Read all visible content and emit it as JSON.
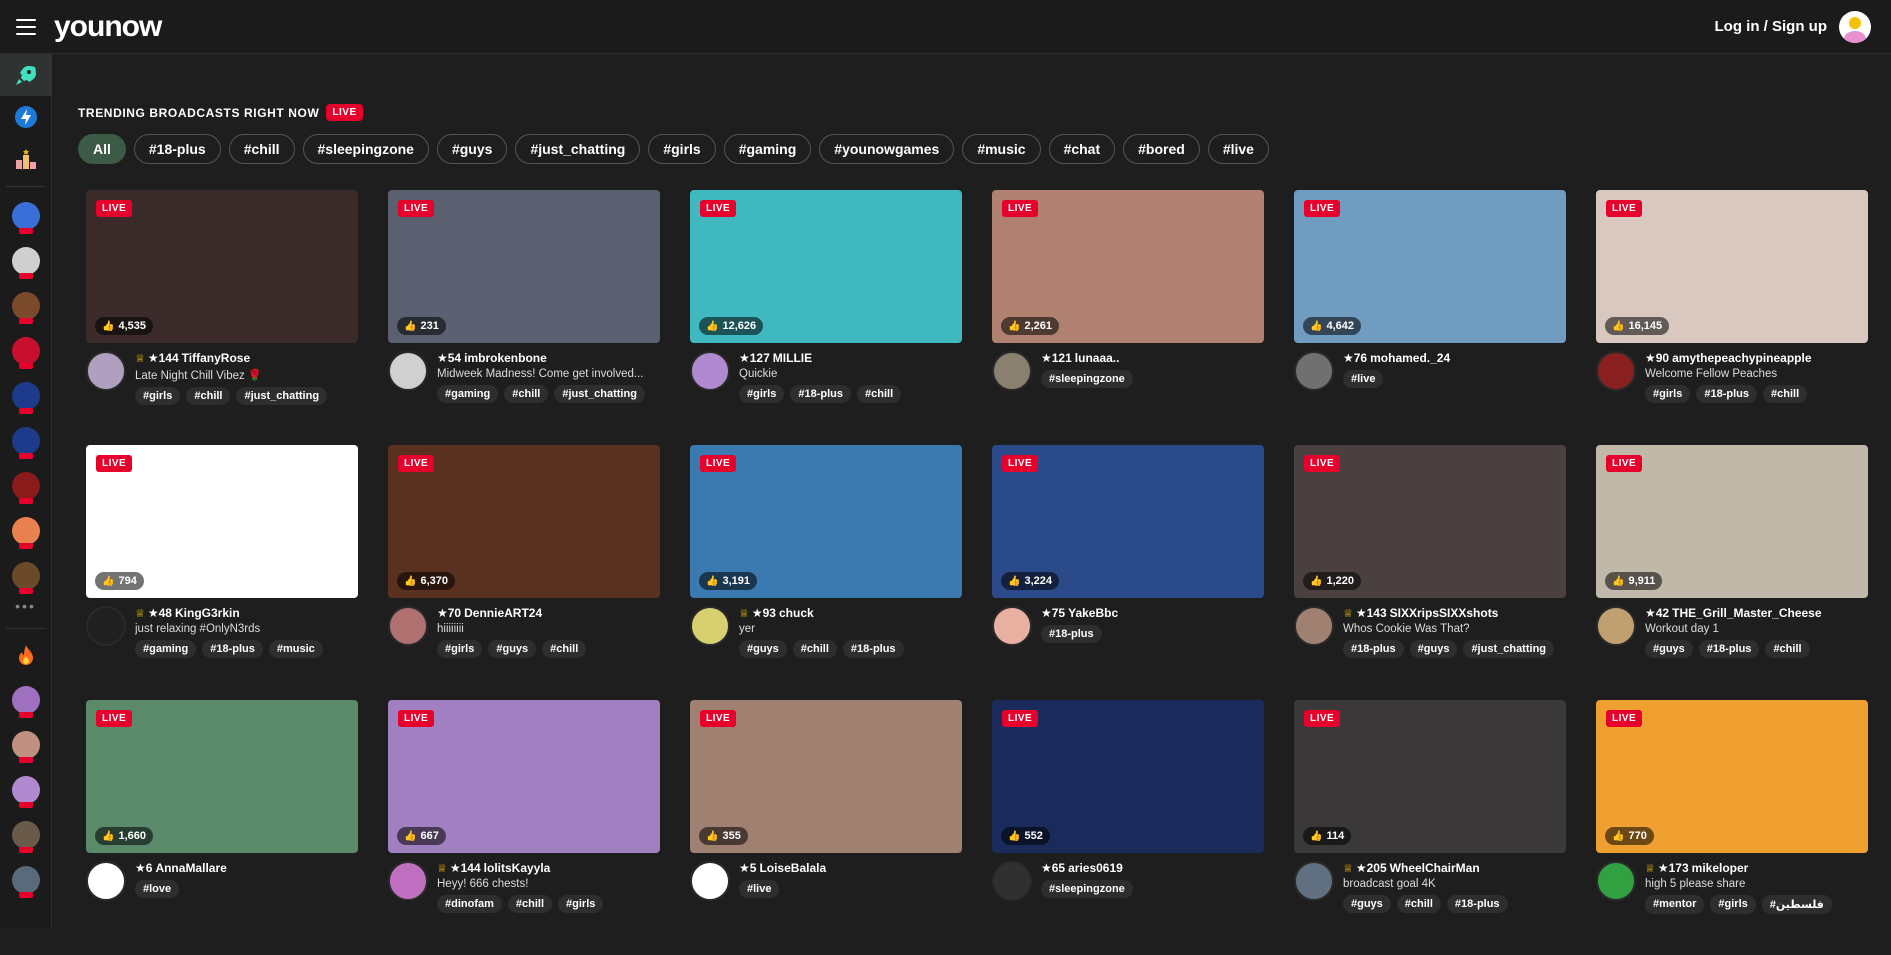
{
  "header": {
    "logo": "younow",
    "login": "Log in / Sign up"
  },
  "sidebar": {
    "nav": [
      {
        "icon": "rocket-icon",
        "active": true
      },
      {
        "icon": "lightning-icon",
        "active": false
      },
      {
        "icon": "podium-icon",
        "active": false
      }
    ],
    "live_avatars": [
      "#3b6fd8",
      "#cfcfcf",
      "#7a4a2a",
      "#c8102e",
      "#1e3a8a",
      "#1e3a8a",
      "#8b1a1a",
      "#e88050",
      "#6b4a2a"
    ],
    "more": "•••",
    "fire_icon": "fire-icon",
    "recent_avatars": [
      "#a070c0",
      "#c09080",
      "#b08ad0",
      "#6a5a4a",
      "#5a6a7a"
    ]
  },
  "section": {
    "title": "TRENDING BROADCASTS RIGHT NOW",
    "badge": "LIVE"
  },
  "filters": [
    "All",
    "#18-plus",
    "#chill",
    "#sleepingzone",
    "#guys",
    "#just_chatting",
    "#girls",
    "#gaming",
    "#younowgames",
    "#music",
    "#chat",
    "#bored",
    "#live"
  ],
  "live_label": "LIVE",
  "cards": [
    {
      "likes": "4,535",
      "crown": true,
      "level": "★144",
      "name": "TiffanyRose",
      "desc": "Late Night Chill Vibez 🌹",
      "tags": [
        "#girls",
        "#chill",
        "#just_chatting"
      ],
      "thumb": "#3a2a2a",
      "avatar": "#b0a0c0"
    },
    {
      "likes": "231",
      "crown": false,
      "level": "★54",
      "name": "imbrokenbone",
      "desc": "Midweek Madness! Come get involved...",
      "tags": [
        "#gaming",
        "#chill",
        "#just_chatting"
      ],
      "thumb": "#5a6070",
      "avatar": "#d0d0d0"
    },
    {
      "likes": "12,626",
      "crown": false,
      "level": "★127",
      "name": "MILLIE",
      "desc": "Quickie",
      "tags": [
        "#girls",
        "#18-plus",
        "#chill"
      ],
      "thumb": "#3fb8c0",
      "avatar": "#b08ad0"
    },
    {
      "likes": "2,261",
      "crown": false,
      "level": "★121",
      "name": "lunaaa..",
      "desc": "",
      "tags": [
        "#sleepingzone"
      ],
      "thumb": "#b08070",
      "avatar": "#8a8070"
    },
    {
      "likes": "4,642",
      "crown": false,
      "level": "★76",
      "name": "mohamed._24",
      "desc": "",
      "tags": [
        "#live"
      ],
      "thumb": "#6f9cc0",
      "avatar": "#707070"
    },
    {
      "likes": "16,145",
      "crown": false,
      "level": "★90",
      "name": "amythepeachypineapple",
      "desc": "Welcome Fellow Peaches",
      "tags": [
        "#girls",
        "#18-plus",
        "#chill"
      ],
      "thumb": "#d8c8c0",
      "avatar": "#8a2020"
    },
    {
      "likes": "794",
      "crown": true,
      "level": "★48",
      "name": "KingG3rkin",
      "desc": "just relaxing #OnlyN3rds",
      "tags": [
        "#gaming",
        "#18-plus",
        "#music"
      ],
      "thumb": "#ffffff",
      "avatar": "#202020"
    },
    {
      "likes": "6,370",
      "crown": false,
      "level": "★70",
      "name": "DennieART24",
      "desc": "hiiiiiiii",
      "tags": [
        "#girls",
        "#guys",
        "#chill"
      ],
      "thumb": "#5a3020",
      "avatar": "#b07070"
    },
    {
      "likes": "3,191",
      "crown": true,
      "level": "★93",
      "name": "chuck",
      "desc": "yer",
      "tags": [
        "#guys",
        "#chill",
        "#18-plus"
      ],
      "thumb": "#3a7ab0",
      "avatar": "#d8d070"
    },
    {
      "likes": "3,224",
      "crown": false,
      "level": "★75",
      "name": "YakeBbc",
      "desc": "",
      "tags": [
        "#18-plus"
      ],
      "thumb": "#2a4a8a",
      "avatar": "#e8b0a0"
    },
    {
      "likes": "1,220",
      "crown": true,
      "level": "★143",
      "name": "SIXXripsSIXXshots",
      "desc": "Whos Cookie Was That?",
      "tags": [
        "#18-plus",
        "#guys",
        "#just_chatting"
      ],
      "thumb": "#4a4040",
      "avatar": "#a08070"
    },
    {
      "likes": "9,911",
      "crown": false,
      "level": "★42",
      "name": "THE_Grill_Master_Cheese",
      "desc": "Workout day 1",
      "tags": [
        "#guys",
        "#18-plus",
        "#chill"
      ],
      "thumb": "#c0b8a8",
      "avatar": "#c0a070"
    },
    {
      "likes": "1,660",
      "crown": false,
      "level": "★6",
      "name": "AnnaMallare",
      "desc": "",
      "tags": [
        "#love"
      ],
      "thumb": "#5a8a6a",
      "avatar": "#ffffff"
    },
    {
      "likes": "667",
      "crown": true,
      "level": "★144",
      "name": "lolitsKayyla",
      "desc": "Heyy! 666 chests!",
      "tags": [
        "#dinofam",
        "#chill",
        "#girls"
      ],
      "thumb": "#a080c0",
      "avatar": "#c070c0"
    },
    {
      "likes": "355",
      "crown": false,
      "level": "★5",
      "name": "LoiseBalala",
      "desc": "",
      "tags": [
        "#live"
      ],
      "thumb": "#a08070",
      "avatar": "#ffffff"
    },
    {
      "likes": "552",
      "crown": false,
      "level": "★65",
      "name": "aries0619",
      "desc": "",
      "tags": [
        "#sleepingzone"
      ],
      "thumb": "#1a2a5a",
      "avatar": "#303030"
    },
    {
      "likes": "114",
      "crown": true,
      "level": "★205",
      "name": "WheelChairMan",
      "desc": "broadcast goal 4K",
      "tags": [
        "#guys",
        "#chill",
        "#18-plus"
      ],
      "thumb": "#3a3838",
      "avatar": "#607080"
    },
    {
      "likes": "770",
      "crown": true,
      "level": "★173",
      "name": "mikeloper",
      "desc": "high 5 please share",
      "tags": [
        "#mentor",
        "#girls",
        "#فلسطين"
      ],
      "thumb": "#f0a030",
      "avatar": "#30a040"
    }
  ]
}
